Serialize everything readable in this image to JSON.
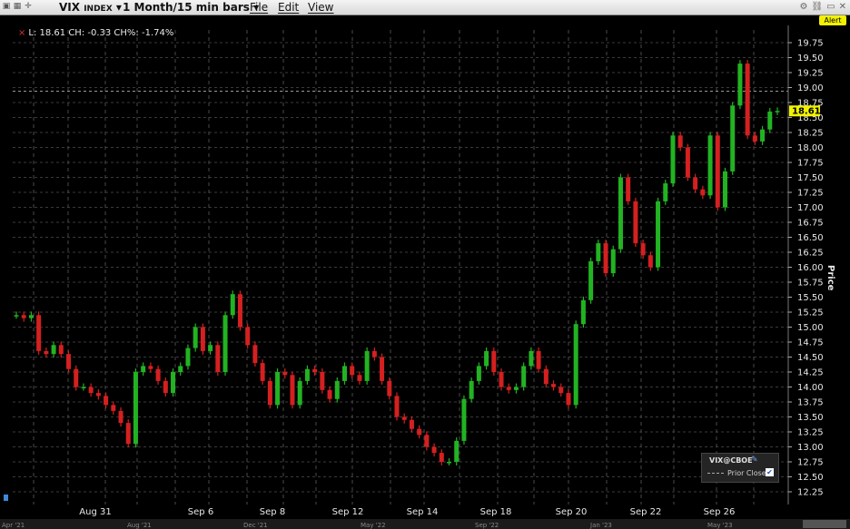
{
  "toolbar": {
    "symbol": "VIX",
    "symbol_sub": "INDEX",
    "timeframe": "1 Month/15 min bars",
    "menu_file": "File",
    "menu_edit": "Edit",
    "menu_view": "View",
    "alert_label": "Alert"
  },
  "readout": {
    "text": "L: 18.61 CH: -0.33 CH%: -1.74%"
  },
  "legend": {
    "title": "VIX@CBOE",
    "prior_close": "Prior Close"
  },
  "nav_labels": [
    "Apr '21",
    "Aug '21",
    "Dec '21",
    "May '22",
    "Sep '22",
    "Jan '23",
    "May '23"
  ],
  "colors": {
    "up": "#22b322",
    "down": "#d42020",
    "last": "#f2f200",
    "axis_text": "#e8e8e8"
  },
  "chart_data": {
    "type": "candlestick",
    "ylabel": "Price",
    "ylim": [
      12.25,
      19.75
    ],
    "y_ticks": [
      12.25,
      12.5,
      12.75,
      13.0,
      13.25,
      13.5,
      13.75,
      14.0,
      14.25,
      14.5,
      14.75,
      15.0,
      15.25,
      15.5,
      15.75,
      16.0,
      16.25,
      16.5,
      16.75,
      17.0,
      17.25,
      17.5,
      17.75,
      18.0,
      18.25,
      18.5,
      18.75,
      19.0,
      19.25,
      19.5,
      19.75
    ],
    "x_labels": [
      "Aug 31",
      "Sep 6",
      "Sep 8",
      "Sep 12",
      "Sep 14",
      "Sep 18",
      "Sep 20",
      "Sep 22",
      "Sep 26"
    ],
    "prior_close": 18.94,
    "last_price": 18.61,
    "series": [
      {
        "values": [
          15.2,
          15.15,
          15.2,
          14.6,
          14.55,
          14.7,
          14.55,
          14.3,
          14.0,
          14.0,
          13.9,
          13.85,
          13.7,
          13.6,
          13.4,
          13.05,
          14.25,
          14.35,
          14.3,
          14.1,
          13.9,
          14.25,
          14.35,
          14.65,
          15.0,
          14.6,
          14.7,
          14.25,
          15.2,
          15.55,
          15.0,
          14.7,
          14.4,
          14.1,
          13.7,
          14.25,
          14.2,
          13.7,
          14.1,
          14.3,
          14.25,
          13.95,
          13.8,
          14.1,
          14.35,
          14.2,
          14.1,
          14.6,
          14.5,
          14.1,
          13.85,
          13.5,
          13.45,
          13.3,
          13.2,
          13.0,
          12.9,
          12.75,
          12.75,
          13.1,
          13.8,
          14.1,
          14.35,
          14.6,
          14.25,
          14.0,
          13.95,
          14.0,
          14.35,
          14.6,
          14.3,
          14.05,
          14.0,
          13.9,
          13.7,
          15.05,
          15.45,
          16.1,
          16.4,
          15.9,
          16.3,
          17.5,
          17.1,
          16.4,
          16.2,
          16.0,
          17.1,
          17.4,
          18.2,
          18.0,
          17.5,
          17.3,
          17.2,
          18.2,
          17.0,
          17.6,
          18.7,
          19.4,
          18.2,
          18.1,
          18.3,
          18.6,
          18.61
        ]
      }
    ]
  }
}
